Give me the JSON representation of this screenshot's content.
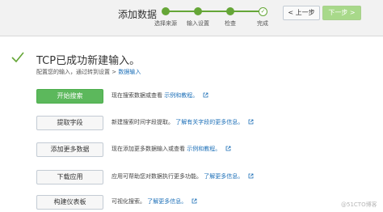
{
  "header": {
    "title": "添加数据",
    "steps": [
      "选择来源",
      "输入设置",
      "检查",
      "完成"
    ],
    "prev_label": "< 上一步",
    "next_label": "下一步 >"
  },
  "success": {
    "title": "TCP已成功新建输入。",
    "subtitle_prefix": "配置您的输入，通过转到设置 > ",
    "subtitle_link": "数据输入"
  },
  "actions": [
    {
      "label": "开始搜索",
      "desc": "现在搜索数据或查看",
      "link": "示例和教程。"
    },
    {
      "label": "提取字段",
      "desc": "新建搜索时间字段提取。",
      "link": "了解有关字段的更多信息。"
    },
    {
      "label": "添加更多数据",
      "desc": "现在添加更多数据输入或查看",
      "link": "示例和教程。"
    },
    {
      "label": "下载应用",
      "desc": "应用可帮助您对数据执行更多功能。",
      "link": "了解更多信息。"
    },
    {
      "label": "构建仪表板",
      "desc": "可视化搜索。",
      "link": "了解更多信息。"
    }
  ],
  "watermark": "@51CTO博客",
  "colors": {
    "accent_green": "#65a637",
    "link_blue": "#1e70b8",
    "primary_button": "#5cb85c"
  }
}
